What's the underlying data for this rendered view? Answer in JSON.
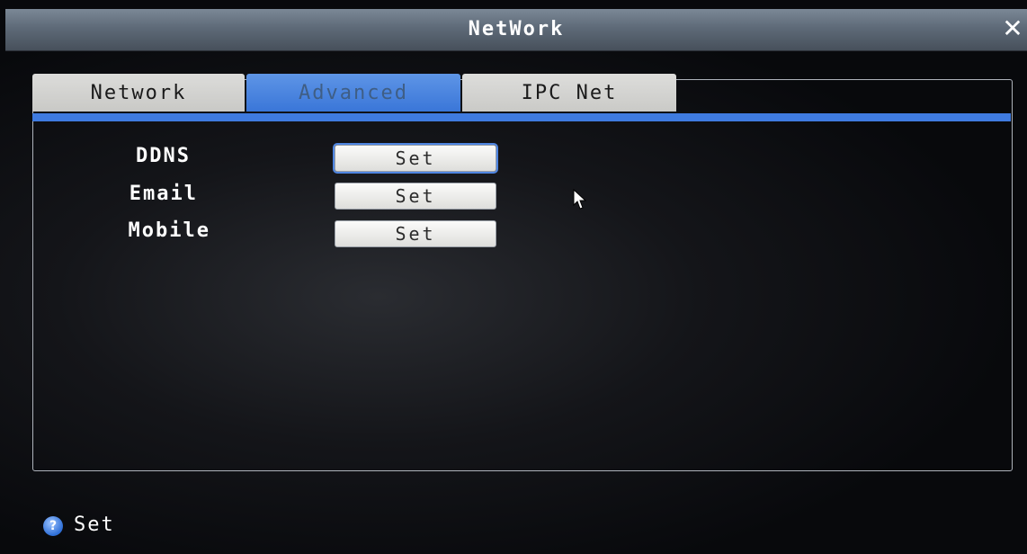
{
  "window": {
    "title": "NetWork",
    "close_icon": "close-icon"
  },
  "tabs": [
    {
      "label": "Network",
      "selected": false
    },
    {
      "label": "Advanced",
      "selected": true
    },
    {
      "label": "IPC Net",
      "selected": false
    }
  ],
  "rows": [
    {
      "label": "DDNS",
      "button": "Set",
      "focused": true
    },
    {
      "label": "Email",
      "button": "Set",
      "focused": false
    },
    {
      "label": "Mobile",
      "button": "Set",
      "focused": false
    }
  ],
  "footer": {
    "help_icon": "help-icon",
    "status": "Set"
  },
  "colors": {
    "accent": "#3f7be0",
    "title_bar": "#5e6a78",
    "tab_inactive": "#d4d4d2",
    "text": "#ffffff"
  }
}
